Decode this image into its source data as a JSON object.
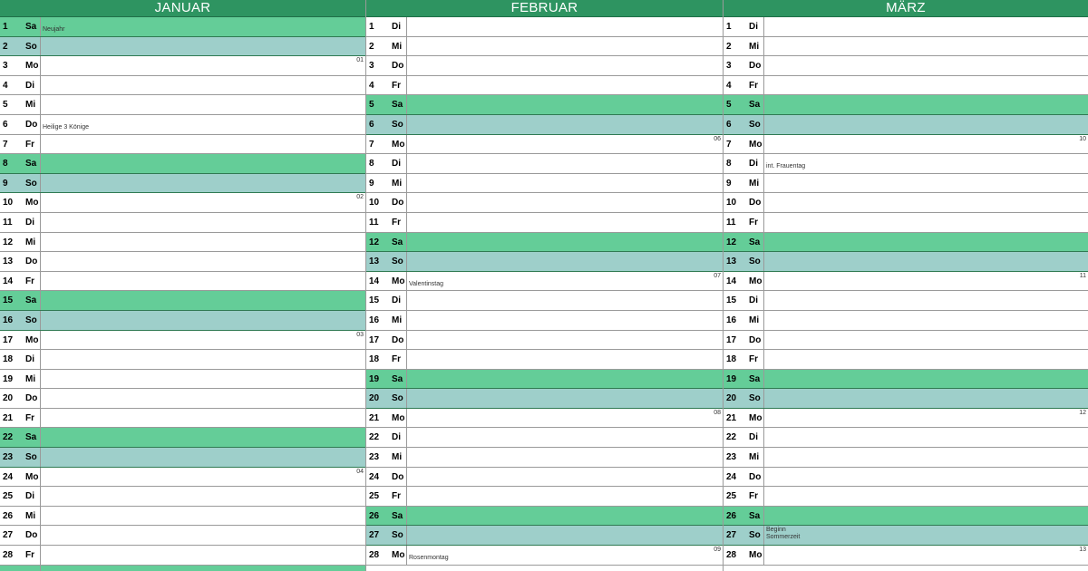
{
  "months": [
    {
      "name": "JANUAR",
      "days": [
        {
          "d": "1",
          "wd": "Sa",
          "note": "Neujahr"
        },
        {
          "d": "2",
          "wd": "So"
        },
        {
          "d": "3",
          "wd": "Mo",
          "week": "01"
        },
        {
          "d": "4",
          "wd": "Di"
        },
        {
          "d": "5",
          "wd": "Mi"
        },
        {
          "d": "6",
          "wd": "Do",
          "note": "Heilige 3 Könige"
        },
        {
          "d": "7",
          "wd": "Fr"
        },
        {
          "d": "8",
          "wd": "Sa"
        },
        {
          "d": "9",
          "wd": "So"
        },
        {
          "d": "10",
          "wd": "Mo",
          "week": "02"
        },
        {
          "d": "11",
          "wd": "Di"
        },
        {
          "d": "12",
          "wd": "Mi"
        },
        {
          "d": "13",
          "wd": "Do"
        },
        {
          "d": "14",
          "wd": "Fr"
        },
        {
          "d": "15",
          "wd": "Sa"
        },
        {
          "d": "16",
          "wd": "So"
        },
        {
          "d": "17",
          "wd": "Mo",
          "week": "03"
        },
        {
          "d": "18",
          "wd": "Di"
        },
        {
          "d": "19",
          "wd": "Mi"
        },
        {
          "d": "20",
          "wd": "Do"
        },
        {
          "d": "21",
          "wd": "Fr"
        },
        {
          "d": "22",
          "wd": "Sa"
        },
        {
          "d": "23",
          "wd": "So"
        },
        {
          "d": "24",
          "wd": "Mo",
          "week": "04"
        },
        {
          "d": "25",
          "wd": "Di"
        },
        {
          "d": "26",
          "wd": "Mi"
        },
        {
          "d": "27",
          "wd": "Do"
        },
        {
          "d": "28",
          "wd": "Fr"
        },
        {
          "d": "",
          "wd": "",
          "kind": "Sa"
        }
      ]
    },
    {
      "name": "FEBRUAR",
      "days": [
        {
          "d": "1",
          "wd": "Di"
        },
        {
          "d": "2",
          "wd": "Mi"
        },
        {
          "d": "3",
          "wd": "Do"
        },
        {
          "d": "4",
          "wd": "Fr"
        },
        {
          "d": "5",
          "wd": "Sa"
        },
        {
          "d": "6",
          "wd": "So"
        },
        {
          "d": "7",
          "wd": "Mo",
          "week": "06"
        },
        {
          "d": "8",
          "wd": "Di"
        },
        {
          "d": "9",
          "wd": "Mi"
        },
        {
          "d": "10",
          "wd": "Do"
        },
        {
          "d": "11",
          "wd": "Fr"
        },
        {
          "d": "12",
          "wd": "Sa"
        },
        {
          "d": "13",
          "wd": "So"
        },
        {
          "d": "14",
          "wd": "Mo",
          "week": "07",
          "note": "Valentinstag"
        },
        {
          "d": "15",
          "wd": "Di"
        },
        {
          "d": "16",
          "wd": "Mi"
        },
        {
          "d": "17",
          "wd": "Do"
        },
        {
          "d": "18",
          "wd": "Fr"
        },
        {
          "d": "19",
          "wd": "Sa"
        },
        {
          "d": "20",
          "wd": "So"
        },
        {
          "d": "21",
          "wd": "Mo",
          "week": "08"
        },
        {
          "d": "22",
          "wd": "Di"
        },
        {
          "d": "23",
          "wd": "Mi"
        },
        {
          "d": "24",
          "wd": "Do"
        },
        {
          "d": "25",
          "wd": "Fr"
        },
        {
          "d": "26",
          "wd": "Sa"
        },
        {
          "d": "27",
          "wd": "So"
        },
        {
          "d": "28",
          "wd": "Mo",
          "week": "09",
          "note": "Rosenmontag"
        }
      ]
    },
    {
      "name": "MÄRZ",
      "days": [
        {
          "d": "1",
          "wd": "Di"
        },
        {
          "d": "2",
          "wd": "Mi"
        },
        {
          "d": "3",
          "wd": "Do"
        },
        {
          "d": "4",
          "wd": "Fr"
        },
        {
          "d": "5",
          "wd": "Sa"
        },
        {
          "d": "6",
          "wd": "So"
        },
        {
          "d": "7",
          "wd": "Mo",
          "week": "10"
        },
        {
          "d": "8",
          "wd": "Di",
          "note": "int. Frauentag"
        },
        {
          "d": "9",
          "wd": "Mi"
        },
        {
          "d": "10",
          "wd": "Do"
        },
        {
          "d": "11",
          "wd": "Fr"
        },
        {
          "d": "12",
          "wd": "Sa"
        },
        {
          "d": "13",
          "wd": "So"
        },
        {
          "d": "14",
          "wd": "Mo",
          "week": "11"
        },
        {
          "d": "15",
          "wd": "Di"
        },
        {
          "d": "16",
          "wd": "Mi"
        },
        {
          "d": "17",
          "wd": "Do"
        },
        {
          "d": "18",
          "wd": "Fr"
        },
        {
          "d": "19",
          "wd": "Sa"
        },
        {
          "d": "20",
          "wd": "So"
        },
        {
          "d": "21",
          "wd": "Mo",
          "week": "12"
        },
        {
          "d": "22",
          "wd": "Di"
        },
        {
          "d": "23",
          "wd": "Mi"
        },
        {
          "d": "24",
          "wd": "Do"
        },
        {
          "d": "25",
          "wd": "Fr"
        },
        {
          "d": "26",
          "wd": "Sa"
        },
        {
          "d": "27",
          "wd": "So",
          "note": "Beginn",
          "note2": "Sommerzeit"
        },
        {
          "d": "28",
          "wd": "Mo",
          "week": "13"
        }
      ]
    }
  ],
  "colors": {
    "header": "#2e9461",
    "saturday": "#64cd98",
    "sunday": "#9ecfca"
  }
}
